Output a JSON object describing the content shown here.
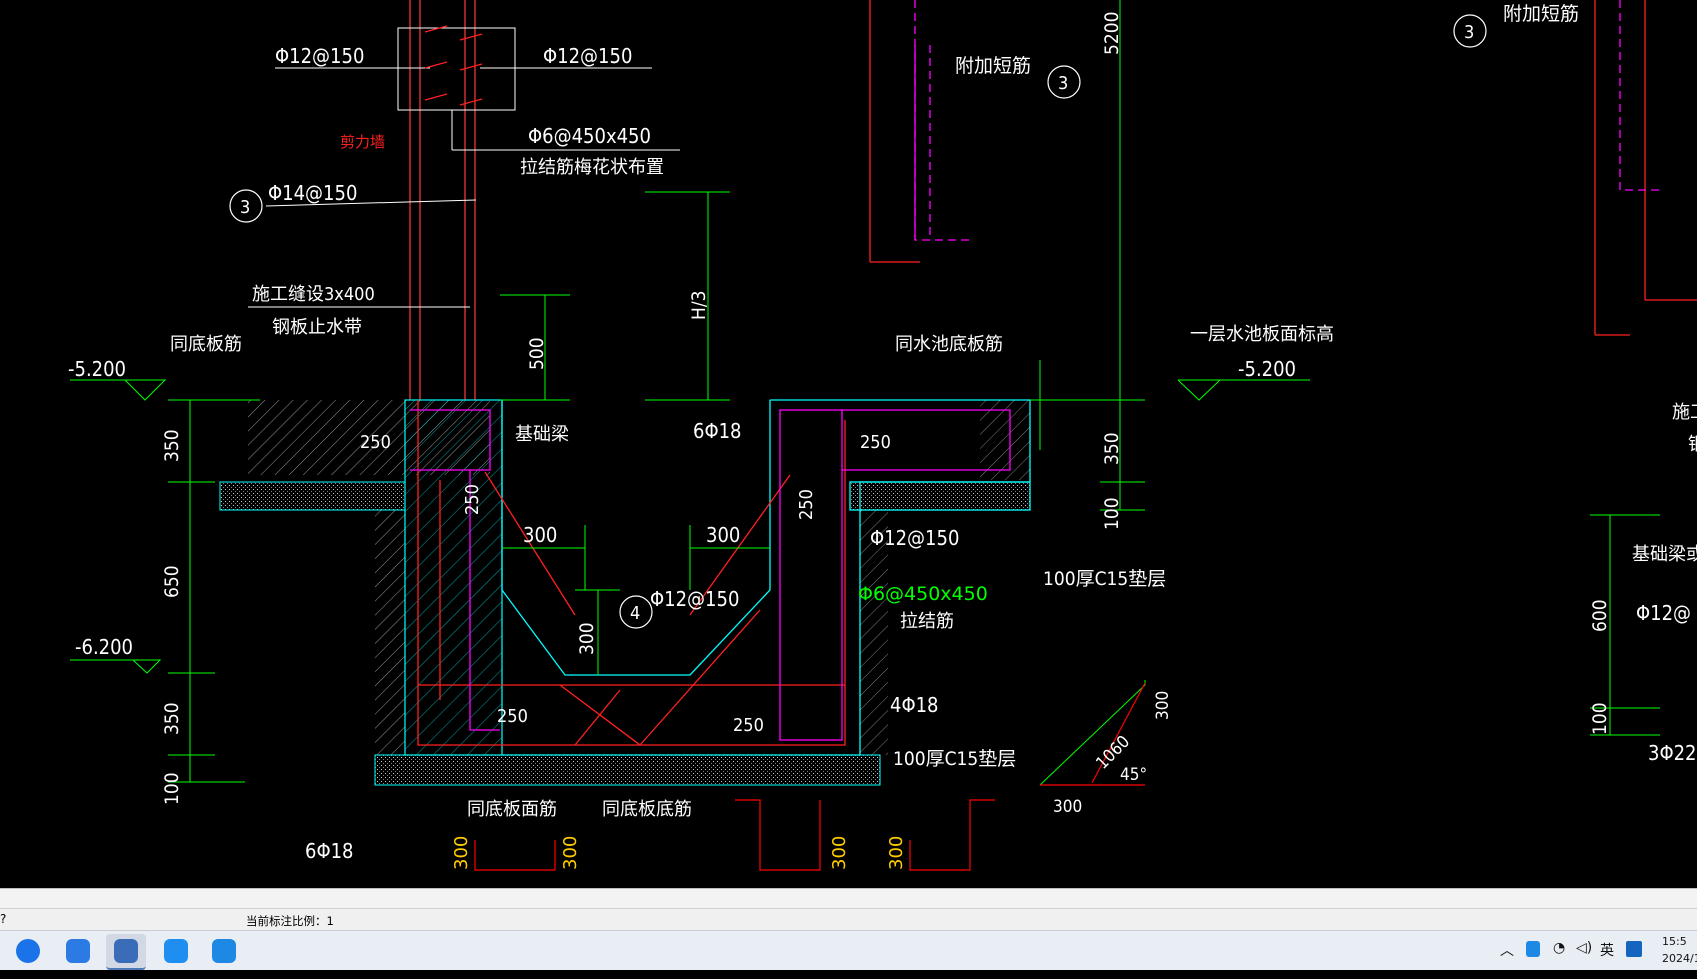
{
  "drawing": {
    "labels": {
      "rebar_top_left": "Φ12@150",
      "rebar_top_right": "Φ12@150",
      "shear_wall": "剪力墙",
      "tie_bar_spec": "Φ6@450x450",
      "tie_bar_layout": "拉结筋梅花状布置",
      "bar_14": "Φ14@150",
      "construction_joint": "施工缝设3x400",
      "steel_waterstop": "钢板止水带",
      "same_bottom_slab_bar": "同底板筋",
      "elev_left": "-5.200",
      "dim_350a": "350",
      "dim_650": "650",
      "elev_lower": "-6.200",
      "dim_350b": "350",
      "dim_100a": "100",
      "dim_250a": "250",
      "dim_250b": "250",
      "foundation_beam": "基础梁",
      "dim_500": "500",
      "dim_h3": "H/3",
      "bars_6phi18_mid": "6Φ18",
      "dim_300a": "300",
      "dim_300b": "300",
      "phi12_150_mid": "Φ12@150",
      "dim_300v": "300",
      "dim_250c": "250",
      "dim_250d": "250",
      "additional_short_bar_1": "附加短筋",
      "dim_5200": "5200",
      "same_pool_bottom_bar": "同水池底板筋",
      "dim_250e": "250",
      "dim_250f": "250",
      "phi12_150_right": "Φ12@150",
      "phi6_green": "Φ6@450x450",
      "tie_bar": "拉结筋",
      "bars_4phi18": "4Φ18",
      "c15_bedding_1": "100厚C15垫层",
      "c15_bedding_2": "100厚C15垫层",
      "same_slab_top_bar": "同底板面筋",
      "same_slab_bottom_bar": "同底板底筋",
      "bars_6phi18_bottom": "6Φ18",
      "dim_300_bl1": "300",
      "dim_300_bl2": "300",
      "dim_300_br1": "300",
      "dim_300_br2": "300",
      "dim_350r": "350",
      "dim_100r": "100",
      "first_floor_elev": "一层水池板面标高",
      "elev_right": "-5.200",
      "dim_1060": "1060",
      "angle_45": "45°",
      "dim_300_diag_top": "300",
      "dim_300_diag_bottom": "300",
      "additional_short_bar_2": "附加短筋",
      "circle_3a": "3",
      "circle_3b": "3",
      "circle_3c": "3",
      "circle_4": "4",
      "found_beam_partial": "基础梁或",
      "phi12_partial": "Φ12@",
      "dim_600": "600",
      "dim_100far": "100",
      "bars_3phi22": "3Φ22",
      "construction_partial": "施工",
      "steel_partial": "钢"
    },
    "colors": {
      "background": "#000000",
      "concrete_outline": "#00ffff",
      "rebar": "#ff0000",
      "stirrup": "#ff00ff",
      "dimension": "#00ff00",
      "text": "#ffffff",
      "shear_wall_label": "#ff2020",
      "highlight_label": "#00ff00"
    }
  },
  "statusbar": {
    "left_cut": "?",
    "scale_label": "当前标注比例：1"
  },
  "taskbar": {
    "apps": [
      {
        "name": "browser-e",
        "color": "#1a73e8"
      },
      {
        "name": "xunlei",
        "color": "#2c7be5"
      },
      {
        "name": "cad",
        "color": "#3a6cb8"
      },
      {
        "name": "app-4",
        "color": "#1f8ef1"
      },
      {
        "name": "app-5",
        "color": "#1e88e5"
      }
    ],
    "tray": {
      "ime": "英",
      "time": "15:5",
      "date": "2024/1("
    }
  }
}
